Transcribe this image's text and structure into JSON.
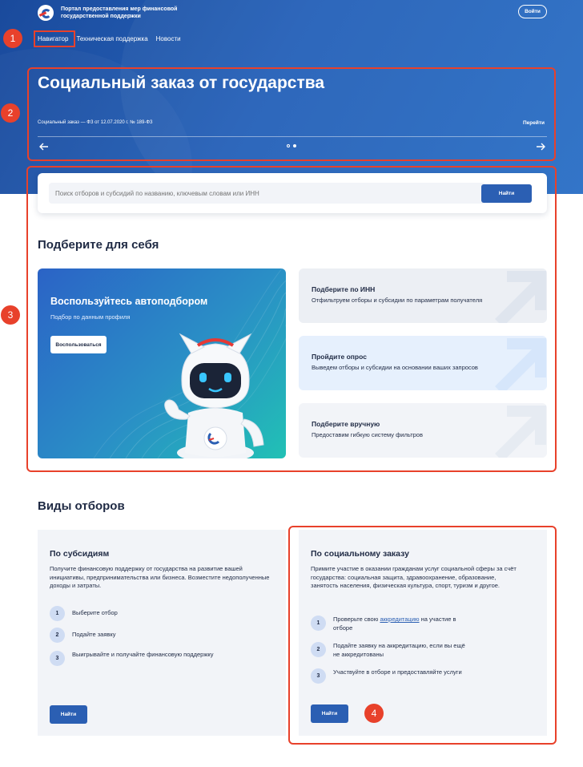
{
  "header": {
    "portal_name": "Портал предоставления мер финансовой государственной поддержки",
    "login_label": "Войти"
  },
  "nav": {
    "items": [
      "Навигатор",
      "Техническая поддержка",
      "Новости"
    ]
  },
  "markers": [
    "1",
    "2",
    "3",
    "4"
  ],
  "hero": {
    "title": "Социальный заказ от государства",
    "subtitle": "Социальный заказ — ФЗ от 12.07.2020 г. № 189-ФЗ",
    "go_label": "Перейти",
    "prev_icon": "arrow-left-icon",
    "next_icon": "arrow-right-icon",
    "slide_count": 2,
    "active_slide": 2
  },
  "search": {
    "placeholder": "Поиск отборов и субсидий по названию, ключевым словам или ИНН",
    "button_label": "Найти"
  },
  "pick_section": {
    "title": "Подберите для себя",
    "auto": {
      "title": "Воспользуйтесь автоподбором",
      "subtitle": "Подбор по данным профиля",
      "button_label": "Воспользоваться"
    },
    "cards": [
      {
        "title": "Подберите по ИНН",
        "subtitle": "Отфильтруем отборы и субсидии по параметрам получателя"
      },
      {
        "title": "Пройдите опрос",
        "subtitle": "Выведем отборы и субсидии на основании ваших запросов"
      },
      {
        "title": "Подберите вручную",
        "subtitle": "Предоставим гибкую систему фильтров"
      }
    ]
  },
  "types_section": {
    "title": "Виды отборов",
    "subsidies": {
      "title": "По субсидиям",
      "description": "Получите финансовую поддержку от государства на развитие вашей инициативы, предпринимательства или бизнеса. Возместите недополученные доходы и затраты.",
      "steps": [
        {
          "num": "1",
          "text": "Выберите отбор"
        },
        {
          "num": "2",
          "text": "Подайте заявку"
        },
        {
          "num": "3",
          "text": "Выигрывайте и получайте финансовую поддержку"
        }
      ],
      "button_label": "Найти"
    },
    "social": {
      "title": "По социальному заказу",
      "description": "Примите участие в оказании гражданам услуг социальной сферы за счёт государства: социальная защита, здравоохранение, образование, занятость населения, физическая культура, спорт, туризм и другое.",
      "steps": [
        {
          "num": "1",
          "text_before": "Проверьте свою ",
          "link": "аккредитацию",
          "text_after": " на участие в отборе"
        },
        {
          "num": "2",
          "text": "Подайте заявку на аккредитацию, если вы ещё не аккредитованы"
        },
        {
          "num": "3",
          "text": "Участвуйте в отборе и предоставляйте услуги"
        }
      ],
      "button_label": "Найти"
    }
  },
  "colors": {
    "hero_blue": "#2561b8",
    "accent_blue": "#2b5fb3",
    "highlight_red": "#e8412b",
    "card_grey": "#f2f4f8"
  }
}
